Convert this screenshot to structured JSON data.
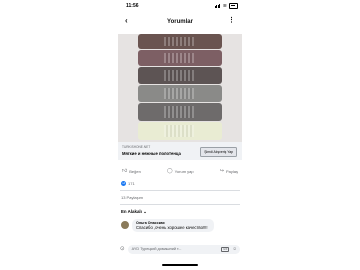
{
  "status": {
    "time": "11:56"
  },
  "header": {
    "title": "Yorumlar"
  },
  "icons": {
    "back": "back-arrow-icon",
    "more": "more-dots-icon"
  },
  "post": {
    "link_domain": "TURKISHONE.NET",
    "link_title": "Мягкие и нежные полотенца",
    "shop_button": "Şimdi Alışveriş Yap",
    "towel_colors": [
      "#6a5450",
      "#7d5f64",
      "#5d5454",
      "#8a8a88",
      "#6e6b6b",
      "#e9ecd3"
    ]
  },
  "actions": {
    "like": "Beğen",
    "comment": "Yorum yap",
    "share": "Paylaş"
  },
  "reactions": {
    "count": "171"
  },
  "shares": {
    "label": "13 Paylaşım"
  },
  "comments": {
    "sort_label": "En Alakalı",
    "items": [
      {
        "author": "Ольга Опасская",
        "text": "Спасибо ,очень хорошее качество!!!!"
      }
    ]
  },
  "composer": {
    "placeholder": "AYD Турецкий домашний т..."
  },
  "colors": {
    "accent": "#1877f2"
  }
}
